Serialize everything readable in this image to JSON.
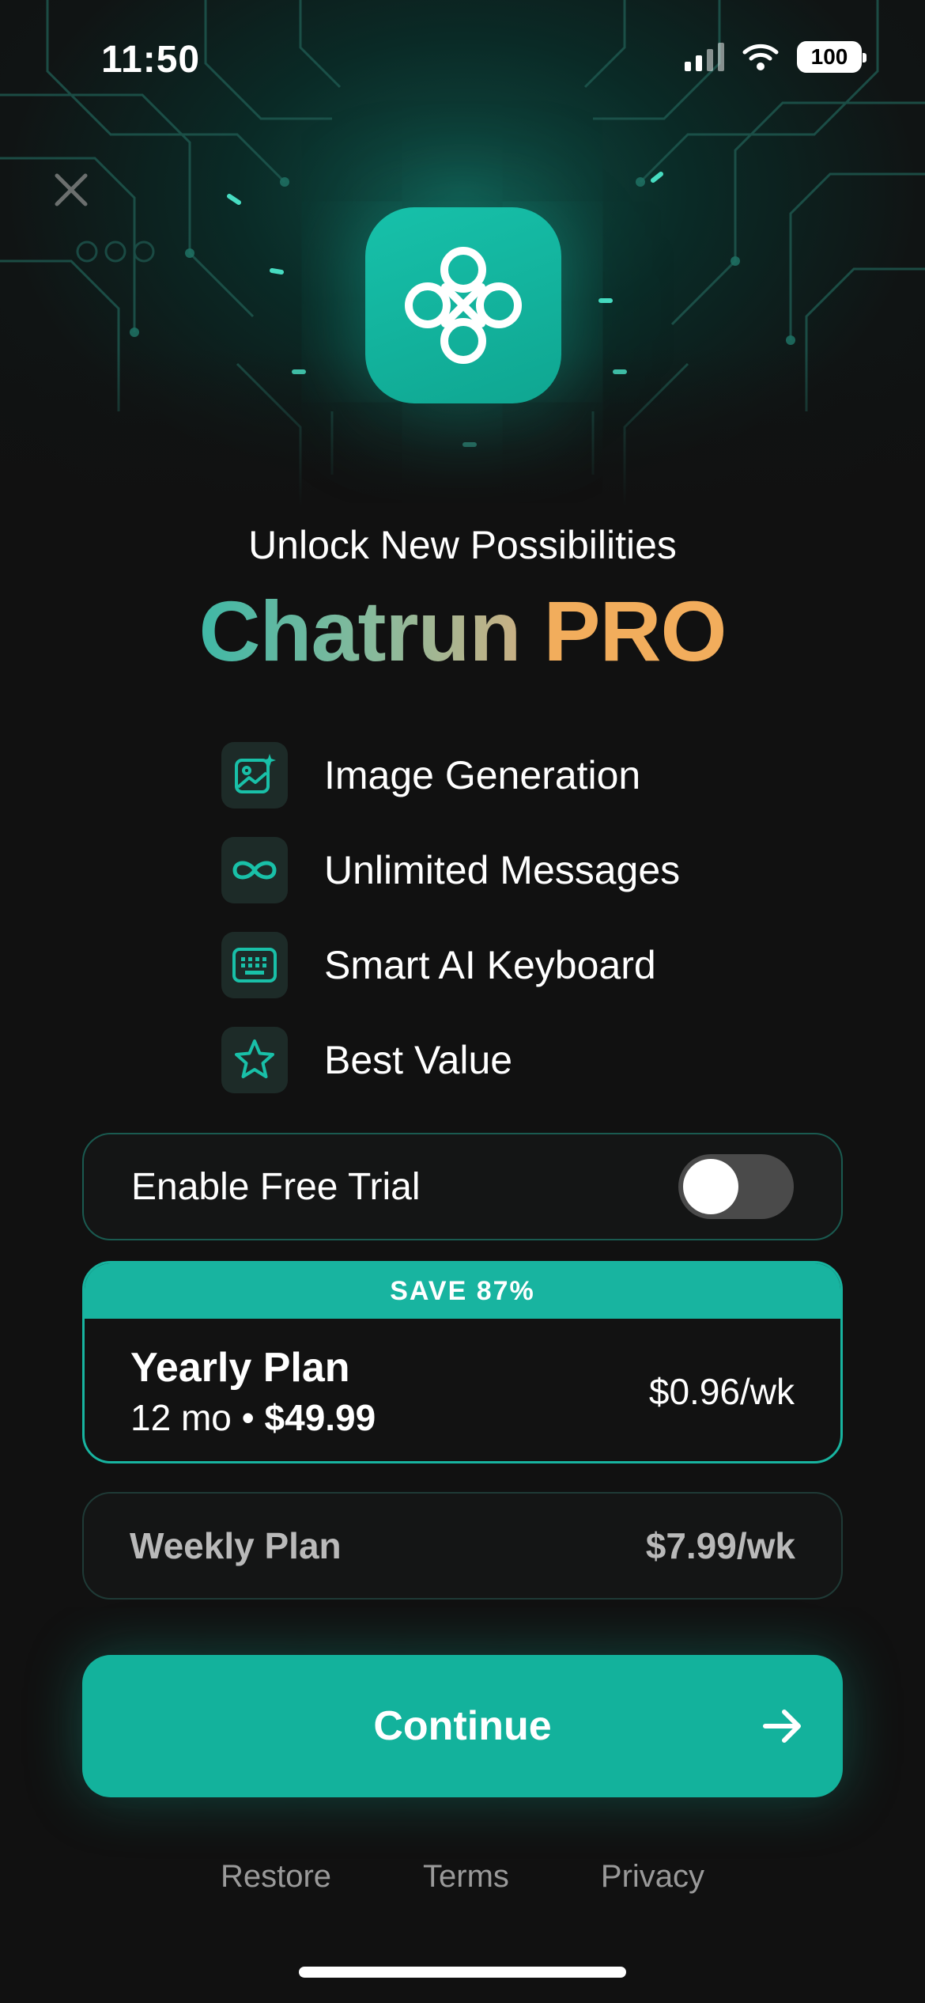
{
  "status_bar": {
    "time": "11:50",
    "battery": "100"
  },
  "hero": {
    "subtitle": "Unlock New Possibilities",
    "brand": "Chatrun",
    "tier": "PRO"
  },
  "features": [
    {
      "label": "Image Generation",
      "icon": "image-sparkle-icon"
    },
    {
      "label": "Unlimited Messages",
      "icon": "infinity-icon"
    },
    {
      "label": "Smart AI Keyboard",
      "icon": "keyboard-icon"
    },
    {
      "label": "Best Value",
      "icon": "star-icon"
    }
  ],
  "trial": {
    "label": "Enable Free Trial",
    "enabled": false
  },
  "plans": {
    "yearly": {
      "badge": "SAVE 87%",
      "name": "Yearly Plan",
      "duration": "12 mo",
      "separator": "•",
      "total": "$49.99",
      "weekly_price": "$0.96/wk"
    },
    "weekly": {
      "name": "Weekly Plan",
      "price": "$7.99/wk"
    }
  },
  "cta": {
    "label": "Continue"
  },
  "footer": {
    "restore": "Restore",
    "terms": "Terms",
    "privacy": "Privacy"
  },
  "colors": {
    "accent": "#13b29c",
    "pro": "#f2ad5c",
    "background": "#111111"
  }
}
